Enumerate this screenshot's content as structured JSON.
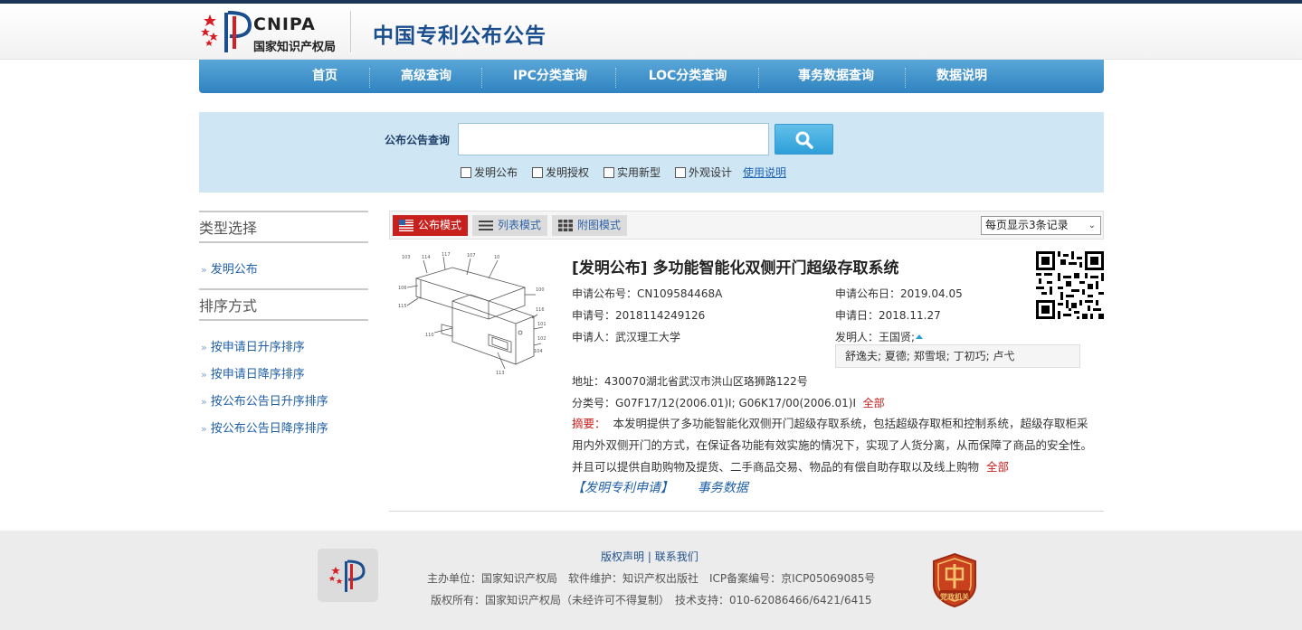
{
  "header": {
    "logo_en": "CNIPA",
    "logo_cn": "国家知识产权局",
    "site_title": "中国专利公布公告"
  },
  "nav": {
    "items": [
      "首页",
      "高级查询",
      "IPC分类查询",
      "LOC分类查询",
      "事务数据查询",
      "数据说明"
    ]
  },
  "search": {
    "label": "公布公告查询",
    "value": "",
    "checkboxes": [
      "发明公布",
      "发明授权",
      "实用新型",
      "外观设计"
    ],
    "help_link": "使用说明"
  },
  "sidebar": {
    "type_heading": "类型选择",
    "type_items": [
      "发明公布"
    ],
    "sort_heading": "排序方式",
    "sort_items": [
      "按申请日升序排序",
      "按申请日降序排序",
      "按公布公告日升序排序",
      "按公布公告日降序排序"
    ]
  },
  "toolbar": {
    "modes": [
      "公布模式",
      "列表模式",
      "附图模式"
    ],
    "per_page": "每页显示3条记录"
  },
  "result": {
    "title": "[发明公布] 多功能智能化双侧开门超级存取系统",
    "pub_no_label": "申请公布号：",
    "pub_no": "CN109584468A",
    "pub_date_label": "申请公布日：",
    "pub_date": "2019.04.05",
    "app_no_label": "申请号：",
    "app_no": "2018114249126",
    "app_date_label": "申请日：",
    "app_date": "2018.11.27",
    "applicant_label": "申请人：",
    "applicant": "武汉理工大学",
    "inventor_label": "发明人：",
    "inventor": "王国贤;",
    "inventors_more": "舒逸夫; 夏德; 郑雪垠; 丁初巧; 卢弋",
    "address_label": "地址：",
    "address": "430070湖北省武汉市洪山区珞狮路122号",
    "class_label": "分类号：",
    "class_value": "G07F17/12(2006.01)I; G06K17/00(2006.01)I",
    "class_all": "全部",
    "abstract_label": "摘要：",
    "abstract": "本发明提供了多功能智能化双侧开门超级存取系统，包括超级存取柜和控制系统，超级存取柜采用内外双侧开门的方式，在保证各功能有效实施的情况下，实现了人货分离，从而保障了商品的安全性。并且可以提供自助购物及提货、二手商品交易、物品的有偿自助存取以及线上购物",
    "abstract_all": "全部",
    "link_app": "【发明专利申请】",
    "link_tx": "事务数据"
  },
  "footer": {
    "link_copyright": "版权声明",
    "link_sep": "|",
    "link_contact": "联系我们",
    "line1": "主办单位：国家知识产权局　软件维护：知识产权出版社　ICP备案编号：京ICP05069085号",
    "line2": "版权所有：国家知识产权局（未经许可不得复制）　技术支持：010-62086466/6421/6415",
    "badge_text": "党政机关"
  },
  "colors": {
    "brand_blue": "#1b4e8f",
    "nav_blue": "#2f83c0",
    "accent_red": "#c8201d",
    "search_bg": "#cfe6f5"
  }
}
